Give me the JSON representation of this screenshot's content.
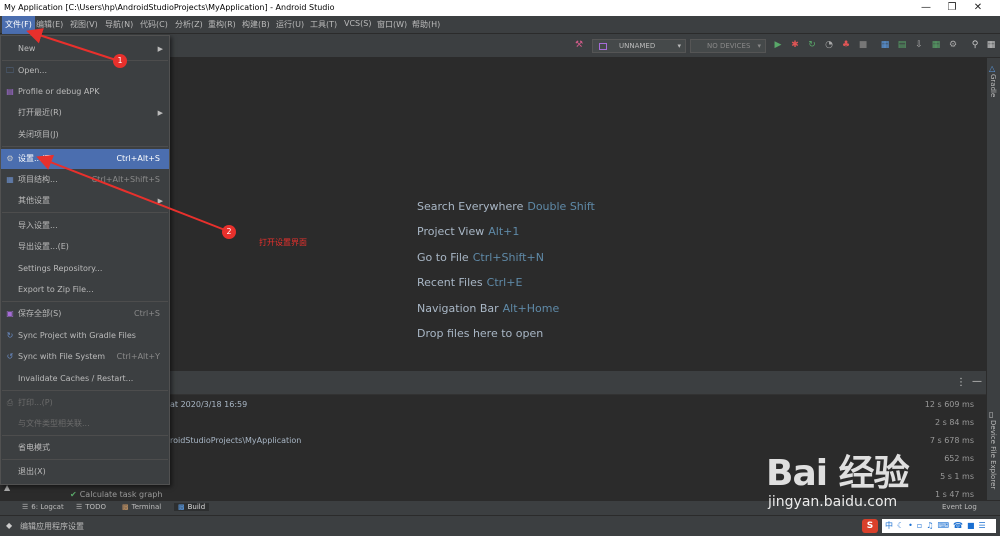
{
  "window": {
    "title": "My Application [C:\\Users\\hp\\AndroidStudioProjects\\MyApplication] - Android Studio"
  },
  "menubar": [
    "文件(F)",
    "编辑(E)",
    "视图(V)",
    "导航(N)",
    "代码(C)",
    "分析(Z)",
    "重构(R)",
    "构建(B)",
    "运行(U)",
    "工具(T)",
    "VCS(S)",
    "窗口(W)",
    "帮助(H)"
  ],
  "toolbar": {
    "config_combo": "UNNAMED",
    "device_combo": "NO DEVICES"
  },
  "file_menu": {
    "items": [
      {
        "label": "New",
        "shortcut": "",
        "submenu": true,
        "icon": "",
        "disabled": false
      },
      {
        "label": "Open...",
        "shortcut": "",
        "submenu": false,
        "icon": "folder-icon",
        "disabled": false
      },
      {
        "label": "Profile or debug APK",
        "shortcut": "",
        "submenu": false,
        "icon": "apk-icon",
        "disabled": false
      },
      {
        "label": "打开最近(R)",
        "shortcut": "",
        "submenu": true,
        "icon": "",
        "disabled": false
      },
      {
        "label": "关闭项目(J)",
        "shortcut": "",
        "submenu": false,
        "icon": "",
        "disabled": false
      },
      {
        "label": "设置...(T)",
        "shortcut": "Ctrl+Alt+S",
        "submenu": false,
        "icon": "gear-icon",
        "disabled": false,
        "selected": true
      },
      {
        "label": "项目结构...",
        "shortcut": "Ctrl+Alt+Shift+S",
        "submenu": false,
        "icon": "project-structure-icon",
        "disabled": false
      },
      {
        "label": "其他设置",
        "shortcut": "",
        "submenu": true,
        "icon": "",
        "disabled": false
      },
      {
        "label": "导入设置...",
        "shortcut": "",
        "submenu": false,
        "icon": "",
        "disabled": false
      },
      {
        "label": "导出设置...(E)",
        "shortcut": "",
        "submenu": false,
        "icon": "",
        "disabled": false
      },
      {
        "label": "Settings Repository...",
        "shortcut": "",
        "submenu": false,
        "icon": "",
        "disabled": false
      },
      {
        "label": "Export to Zip File...",
        "shortcut": "",
        "submenu": false,
        "icon": "",
        "disabled": false
      },
      {
        "label": "保存全部(S)",
        "shortcut": "Ctrl+S",
        "submenu": false,
        "icon": "save-icon",
        "disabled": false
      },
      {
        "label": "Sync Project with Gradle Files",
        "shortcut": "",
        "submenu": false,
        "icon": "gradle-sync-icon",
        "disabled": false
      },
      {
        "label": "Sync with File System",
        "shortcut": "Ctrl+Alt+Y",
        "submenu": false,
        "icon": "sync-icon",
        "disabled": false
      },
      {
        "label": "Invalidate Caches / Restart...",
        "shortcut": "",
        "submenu": false,
        "icon": "",
        "disabled": false
      },
      {
        "label": "打印...(P)",
        "shortcut": "",
        "submenu": false,
        "icon": "print-icon",
        "disabled": true
      },
      {
        "label": "与文件类型相关联...",
        "shortcut": "",
        "submenu": false,
        "icon": "",
        "disabled": true
      },
      {
        "label": "省电模式",
        "shortcut": "",
        "submenu": false,
        "icon": "",
        "disabled": false
      },
      {
        "label": "退出(X)",
        "shortcut": "",
        "submenu": false,
        "icon": "",
        "disabled": false
      }
    ]
  },
  "editor_hints": [
    {
      "label": "Search Everywhere",
      "key": "Double Shift"
    },
    {
      "label": "Project View",
      "key": "Alt+1"
    },
    {
      "label": "Go to File",
      "key": "Ctrl+Shift+N"
    },
    {
      "label": "Recent Files",
      "key": "Ctrl+E"
    },
    {
      "label": "Navigation Bar",
      "key": "Alt+Home"
    },
    {
      "label": "Drop files here to open",
      "key": ""
    }
  ],
  "build": {
    "lines": [
      {
        "text": "at 2020/3/18 16:59",
        "time": "12 s 609 ms"
      },
      {
        "text": "",
        "time": "2 s 84 ms"
      },
      {
        "text": "roidStudioProjects\\MyApplication",
        "time": "7 s 678 ms"
      },
      {
        "text": "",
        "time": "652 ms"
      },
      {
        "text": "",
        "time": "5 s 1 ms"
      },
      {
        "text": "Calculate task graph",
        "time": "1 s 47 ms"
      }
    ]
  },
  "right_strip": {
    "gradle": "Gradle",
    "device_explorer": "Device File Explorer"
  },
  "bottom_tabs": [
    "6: Logcat",
    "TODO",
    "Terminal",
    "Build",
    "Event Log"
  ],
  "statusbar": {
    "text": "编辑应用程序设置"
  },
  "annotations": {
    "badge1": "1",
    "badge2": "2",
    "label": "打开设置界面",
    "color": "#e8302c"
  },
  "watermark": {
    "brand": "Bai 经验",
    "url": "jingyan.baidu.com"
  }
}
